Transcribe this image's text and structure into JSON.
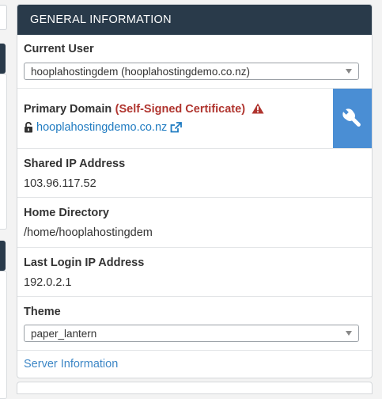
{
  "panel": {
    "title": "GENERAL INFORMATION"
  },
  "current_user": {
    "label": "Current User",
    "selected": "hooplahostingdem (hooplahostingdemo.co.nz)"
  },
  "primary_domain": {
    "label": "Primary Domain",
    "cert_status": "(Self-Signed Certificate)",
    "domain": "hooplahostingdemo.co.nz",
    "icons": [
      "warning-triangle-icon",
      "unlock-icon",
      "external-link-icon",
      "wrench-icon"
    ]
  },
  "shared_ip": {
    "label": "Shared IP Address",
    "value": "103.96.117.52"
  },
  "home_directory": {
    "label": "Home Directory",
    "value": "/home/hooplahostingdem"
  },
  "last_login_ip": {
    "label": "Last Login IP Address",
    "value": "192.0.2.1"
  },
  "theme": {
    "label": "Theme",
    "selected": "paper_lantern"
  },
  "server_info_link": "Server Information",
  "colors": {
    "header_bg": "#293a4a",
    "cert_red": "#b0352f",
    "link_blue": "#1f7bc1",
    "wrench_bg": "#4a8ed4"
  }
}
